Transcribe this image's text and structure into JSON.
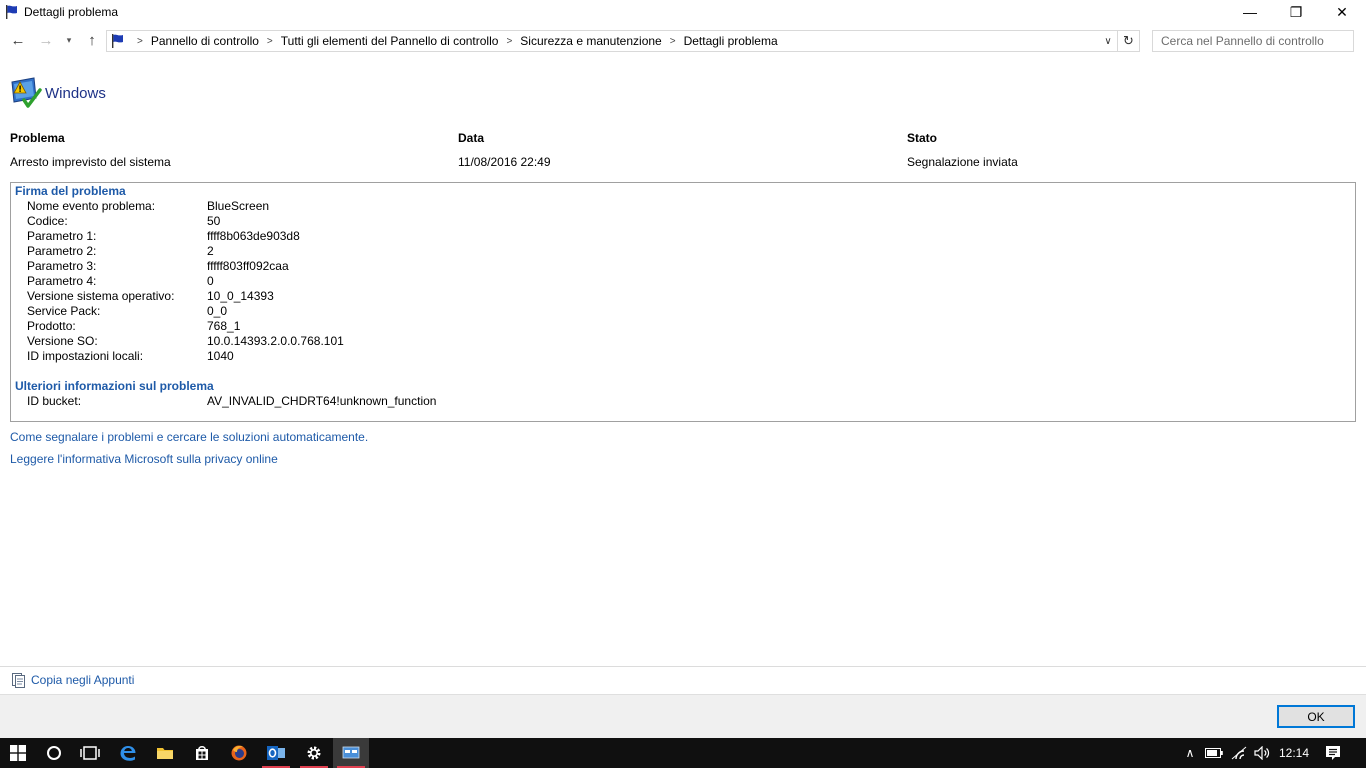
{
  "window": {
    "title": "Dettagli problema",
    "minimize_glyph": "—",
    "maximize_glyph": "❐",
    "close_glyph": "✕"
  },
  "nav": {
    "back_glyph": "←",
    "forward_glyph": "→",
    "recent_glyph": "▾",
    "up_glyph": "↑",
    "breadcrumbs": [
      "Pannello di controllo",
      "Tutti gli elementi del Pannello di controllo",
      "Sicurezza e manutenzione",
      "Dettagli problema"
    ],
    "crumb_sep": ">",
    "dropdown_glyph": "∨",
    "refresh_glyph": "↻",
    "search_placeholder": "Cerca nel Pannello di controllo"
  },
  "header": {
    "product": "Windows",
    "icon": "windows-warning-icon"
  },
  "summary": {
    "problem_label": "Problema",
    "problem_value": "Arresto imprevisto del sistema",
    "date_label": "Data",
    "date_value": "11/08/2016 22:49",
    "status_label": "Stato",
    "status_value": "Segnalazione inviata"
  },
  "signature": {
    "title": "Firma del problema",
    "rows": [
      {
        "key": "Nome evento problema:",
        "value": "BlueScreen"
      },
      {
        "key": "Codice:",
        "value": "50"
      },
      {
        "key": "Parametro 1:",
        "value": "ffff8b063de903d8"
      },
      {
        "key": "Parametro 2:",
        "value": "2"
      },
      {
        "key": "Parametro 3:",
        "value": "fffff803ff092caa"
      },
      {
        "key": "Parametro 4:",
        "value": "0"
      },
      {
        "key": "Versione sistema operativo:",
        "value": "10_0_14393"
      },
      {
        "key": "Service Pack:",
        "value": "0_0"
      },
      {
        "key": "Prodotto:",
        "value": "768_1"
      },
      {
        "key": "Versione SO:",
        "value": "10.0.14393.2.0.0.768.101"
      },
      {
        "key": "ID impostazioni locali:",
        "value": "1040"
      }
    ]
  },
  "more_info": {
    "title": "Ulteriori informazioni sul problema",
    "rows": [
      {
        "key": "ID bucket:",
        "value": "AV_INVALID_CHDRT64!unknown_function"
      }
    ]
  },
  "links": {
    "how_to_report": "Come segnalare i problemi e cercare le soluzioni automaticamente.",
    "privacy": "Leggere l'informativa Microsoft sulla privacy online"
  },
  "copy": {
    "label": "Copia negli Appunti",
    "icon": "clipboard-icon"
  },
  "footer": {
    "ok_label": "OK"
  },
  "taskbar": {
    "time": "12:14",
    "tray_up_glyph": "∧",
    "apps": [
      "start-icon",
      "search-icon",
      "task-view-icon",
      "edge-icon",
      "file-explorer-icon",
      "store-icon",
      "firefox-icon",
      "outlook-icon",
      "settings-icon",
      "control-panel-icon"
    ]
  },
  "colors": {
    "link": "#1e5aa8",
    "header_text": "#1e3287",
    "taskbar": "#101010",
    "ok_border": "#0078d7"
  }
}
